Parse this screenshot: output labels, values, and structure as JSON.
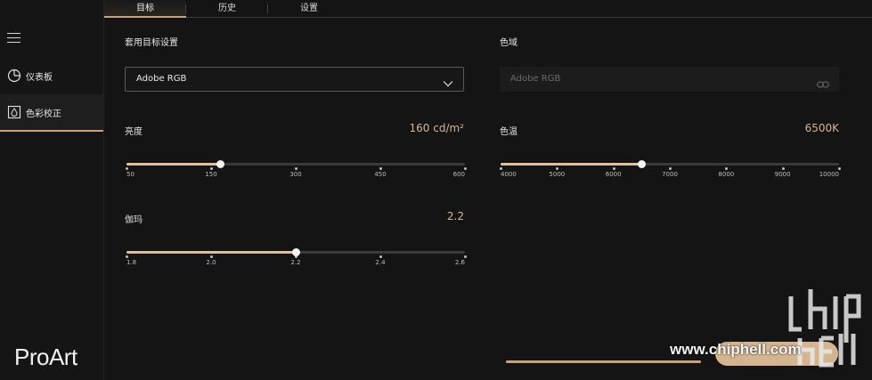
{
  "sidebar": {
    "menu_icon": "hamburger-menu-icon",
    "items": [
      {
        "label": "仪表板",
        "icon": "pie-chart-icon"
      },
      {
        "label": "色彩校正",
        "icon": "color-drop-icon"
      }
    ],
    "logo": "ProArt"
  },
  "tabs": [
    {
      "label": "目标"
    },
    {
      "label": "历史"
    },
    {
      "label": "设置"
    }
  ],
  "target": {
    "apply_target_label": "套用目标设置",
    "dropdown_value": "Adobe RGB",
    "gamut_label": "色域",
    "gamut_value": "Adobe RGB"
  },
  "brightness": {
    "label": "亮度",
    "value": "160 cd/m²",
    "ticks": [
      "50",
      "150",
      "300",
      "450",
      "600"
    ],
    "fraction": 0.276
  },
  "color_temp": {
    "label": "色温",
    "value": "6500K",
    "ticks": [
      "4000",
      "5000",
      "6000",
      "7000",
      "8000",
      "9000",
      "10000"
    ],
    "fraction": 0.417
  },
  "gamma": {
    "label": "伽玛",
    "value": "2.2",
    "ticks": [
      "1.8",
      "2.0",
      "2.2",
      "2.4",
      "2.6"
    ],
    "fraction": 0.5
  },
  "watermark": {
    "url": "www.chiphell.com"
  },
  "colors": {
    "accent": "#c9a27a",
    "value_text": "#d7b48f",
    "background": "#141414"
  }
}
